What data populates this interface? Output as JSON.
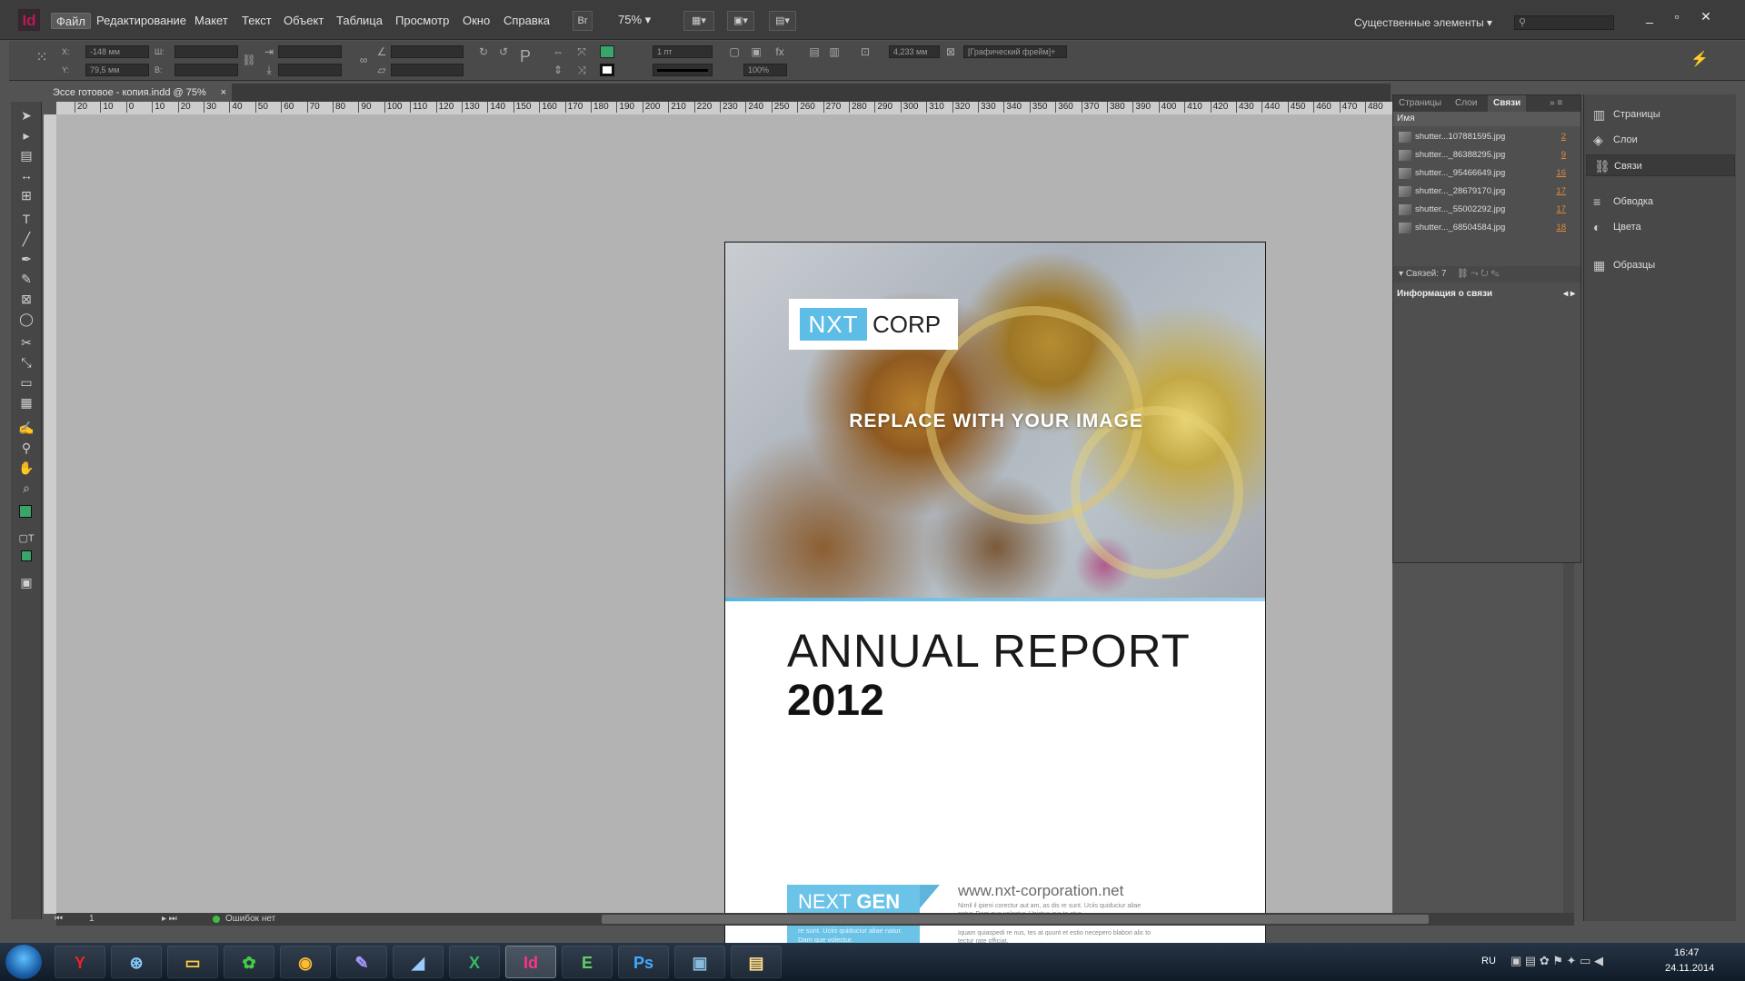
{
  "app": {
    "logo": "Id",
    "menu": [
      "Файл",
      "Редактирование",
      "Макет",
      "Текст",
      "Объект",
      "Таблица",
      "Просмотр",
      "Окно",
      "Справка"
    ],
    "bridge_label": "Br",
    "zoom": "75%",
    "workspace": "Существенные элементы",
    "window_controls": [
      "_",
      "▫",
      "✕"
    ]
  },
  "control": {
    "x_label": "X:",
    "x_value": "-148 мм",
    "y_label": "Y:",
    "y_value": "79,5 мм",
    "w_label": "Ш:",
    "h_label": "В:",
    "stroke_weight": "1 пт",
    "ref_value": "4,233 мм",
    "opacity": "100%",
    "frame_style": "[Графический фрейм]+"
  },
  "document": {
    "tab_title": "Эссе готовое - копия.indd @ 75%",
    "tab_close": "×"
  },
  "ruler": [
    "20",
    "10",
    "0",
    "10",
    "20",
    "30",
    "40",
    "50",
    "60",
    "70",
    "80",
    "90",
    "100",
    "110",
    "120",
    "130",
    "140",
    "150",
    "160",
    "170",
    "180",
    "190",
    "200",
    "210",
    "220",
    "230",
    "240",
    "250",
    "260",
    "270",
    "280",
    "290",
    "300",
    "310",
    "320",
    "330",
    "340",
    "350",
    "360",
    "370",
    "380",
    "390",
    "400",
    "410",
    "420",
    "430",
    "440",
    "450",
    "460",
    "470",
    "480"
  ],
  "page": {
    "logo_nxt": "NXT",
    "logo_corp": "CORP",
    "image_placeholder": "REPLACE WITH YOUR IMAGE",
    "title_line1": "ANNUAL REPORT",
    "title_line2": "2012",
    "next": "NEXT",
    "gen": "GEN",
    "next_gen_text": "Nimil il ipieni corectur aut am, as dis re sunt. Uciis quiduciur aliae natur. Dam que volectur.",
    "url": "www.nxt-corporation.net",
    "para1": "Nimil il ipieni corectur aut am, as dis re sunt. Uciis quiduciur aliae natur. Dam que volectur. Upictus ipic to etur.",
    "para2": "Iquam quiaspedi re nus, tes at quunt et estio necepero blabori alic to tectur rate officiat."
  },
  "status": {
    "page_number": "1",
    "errors": "Ошибок нет"
  },
  "links_panel": {
    "tabs": [
      "Страницы",
      "Слои",
      "Связи"
    ],
    "name_header": "Имя",
    "links": [
      {
        "name": "shutter...107881595.jpg",
        "page": "2"
      },
      {
        "name": "shutter..._86388295.jpg",
        "page": "9"
      },
      {
        "name": "shutter..._95466649.jpg",
        "page": "16"
      },
      {
        "name": "shutter..._28679170.jpg",
        "page": "17"
      },
      {
        "name": "shutter..._55002292.jpg",
        "page": "17"
      },
      {
        "name": "shutter..._68504584.jpg",
        "page": "18"
      }
    ],
    "count": "Связей: 7",
    "info_title": "Информация о связи"
  },
  "right_panel": {
    "items": [
      "Страницы",
      "Слои",
      "Связи",
      "Обводка",
      "Цвета",
      "Образцы"
    ]
  },
  "taskbar": {
    "apps": [
      "Y",
      "⊛",
      "▭",
      "✿",
      "◉",
      "✎",
      "◢",
      "X",
      "Id",
      "E",
      "Ps",
      "▣",
      "▤"
    ],
    "lang": "RU",
    "time": "16:47",
    "date": "24.11.2014"
  },
  "colors": {
    "accent_blue": "#5ebde7",
    "indesign_pink": "#c4145a",
    "link_page_orange": "#e08a3a"
  }
}
